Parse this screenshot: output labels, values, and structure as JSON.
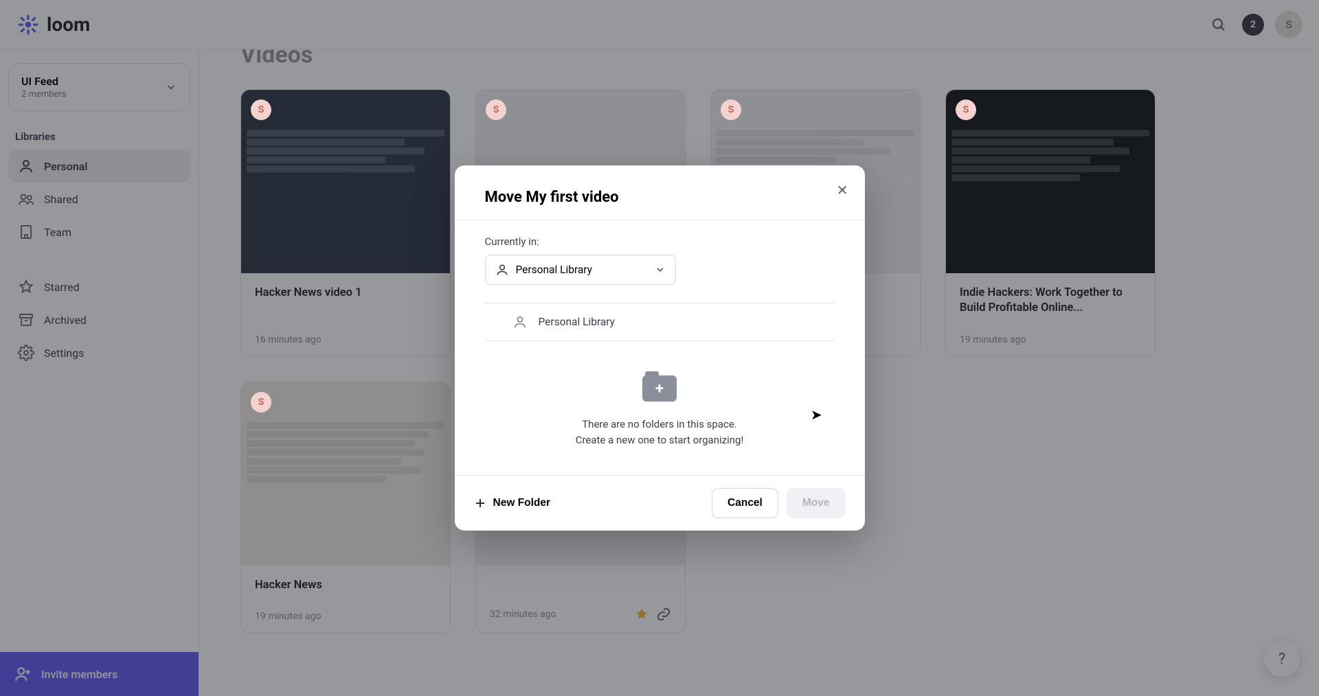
{
  "brand": "loom",
  "topbar": {
    "notif_count": "2",
    "avatar_initial": "S"
  },
  "spaces": {
    "title": "UI Feed",
    "subtitle": "2 members"
  },
  "section_label": "Libraries",
  "nav": {
    "personal": "Personal",
    "shared": "Shared",
    "team": "Team",
    "starred": "Starred",
    "archived": "Archived",
    "settings": "Settings"
  },
  "invite": "Invite members",
  "page_title": "Videos",
  "cards": [
    {
      "avatar": "S",
      "title": "Hacker News video 1",
      "time": "16 minutes ago"
    },
    {
      "avatar": "S",
      "title": "",
      "time": ""
    },
    {
      "avatar": "S",
      "title": "",
      "time": ""
    },
    {
      "avatar": "S",
      "title": "Indie Hackers: Work Together to Build Profitable Online...",
      "time": "19 minutes ago"
    },
    {
      "avatar": "S",
      "title": "Hacker News",
      "time": "19 minutes ago"
    },
    {
      "avatar": "",
      "title": "",
      "time": "32 minutes ago"
    }
  ],
  "modal": {
    "title": "Move My first video",
    "currently_in": "Currently in:",
    "location": "Personal Library",
    "folder_option": "Personal Library",
    "empty_line1": "There are no folders in this space.",
    "empty_line2": "Create a new one to start organizing!",
    "new_folder": "New Folder",
    "cancel": "Cancel",
    "move": "Move"
  }
}
